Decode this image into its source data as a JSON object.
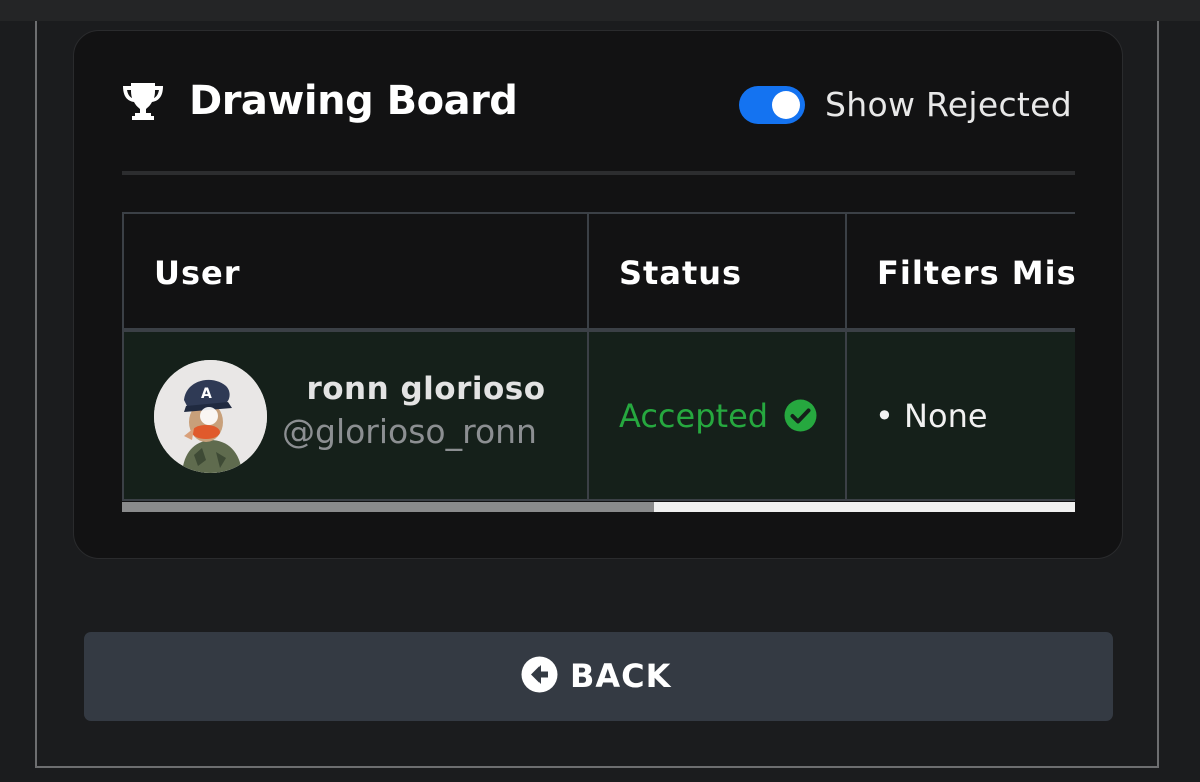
{
  "card": {
    "title": "Drawing Board",
    "toggle": {
      "label": "Show Rejected",
      "checked": true,
      "color": "#1473f1"
    }
  },
  "table": {
    "columns": [
      "User",
      "Status",
      "Filters Miss"
    ],
    "rows": [
      {
        "user_name": "ronn glorioso",
        "user_handle": "@glorioso_ronn",
        "status": "Accepted",
        "filters": "• None"
      }
    ]
  },
  "colors": {
    "accepted_green": "#26a83f",
    "row_bg": "#15201a",
    "button_bg": "#343a43"
  },
  "icons": {
    "title_icon": "trophy-icon",
    "status_icon": "check-circle-icon",
    "back_icon": "arrow-circle-left-icon"
  },
  "back_button": {
    "label": "BACK"
  }
}
